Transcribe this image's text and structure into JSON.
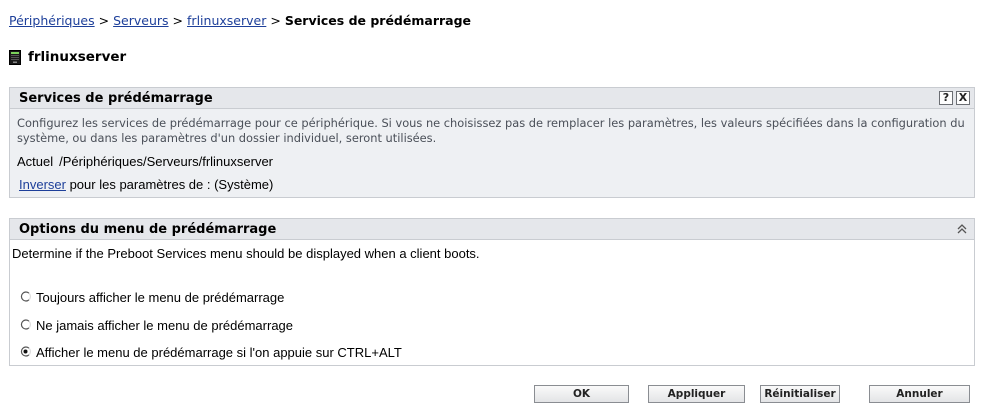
{
  "breadcrumb": {
    "items": [
      "Périphériques",
      "Serveurs",
      "frlinuxserver"
    ],
    "separator": ">",
    "current": "Services de prédémarrage"
  },
  "device": {
    "name": "frlinuxserver",
    "icon": "server-icon"
  },
  "preboot_panel": {
    "title": "Services de prédémarrage",
    "help_label": "?",
    "close_label": "X",
    "description": "Configurez les services de prédémarrage pour ce périphérique. Si vous ne choisissez pas de remplacer les paramètres, les valeurs spécifiées dans la configuration du système, ou dans les paramètres d'un dossier individuel, seront utilisées.",
    "current_label": "Actuel",
    "current_path": "/Périphériques/Serveurs/frlinuxserver",
    "invert_link": "Inverser",
    "invert_suffix": " pour les paramètres de : (Système)"
  },
  "menu_panel": {
    "title": "Options du menu de prédémarrage",
    "collapse_icon": "double-chevron-up-icon",
    "description": "Determine if the Preboot Services menu should be displayed when a client boots.",
    "options": [
      {
        "label": "Toujours afficher le menu de prédémarrage",
        "selected": false
      },
      {
        "label": "Ne jamais afficher le menu de prédémarrage",
        "selected": false
      },
      {
        "label": "Afficher le menu de prédémarrage si l'on appuie sur CTRL+ALT",
        "selected": true
      }
    ]
  },
  "actions": {
    "ok": "OK",
    "apply": "Appliquer",
    "reset": "Réinitialiser",
    "cancel": "Annuler"
  },
  "colors": {
    "link": "#1d3f9a",
    "panel_header_bg": "#e5e7eb",
    "panel_bg": "#eef0f3",
    "border": "#c9ccd1"
  }
}
